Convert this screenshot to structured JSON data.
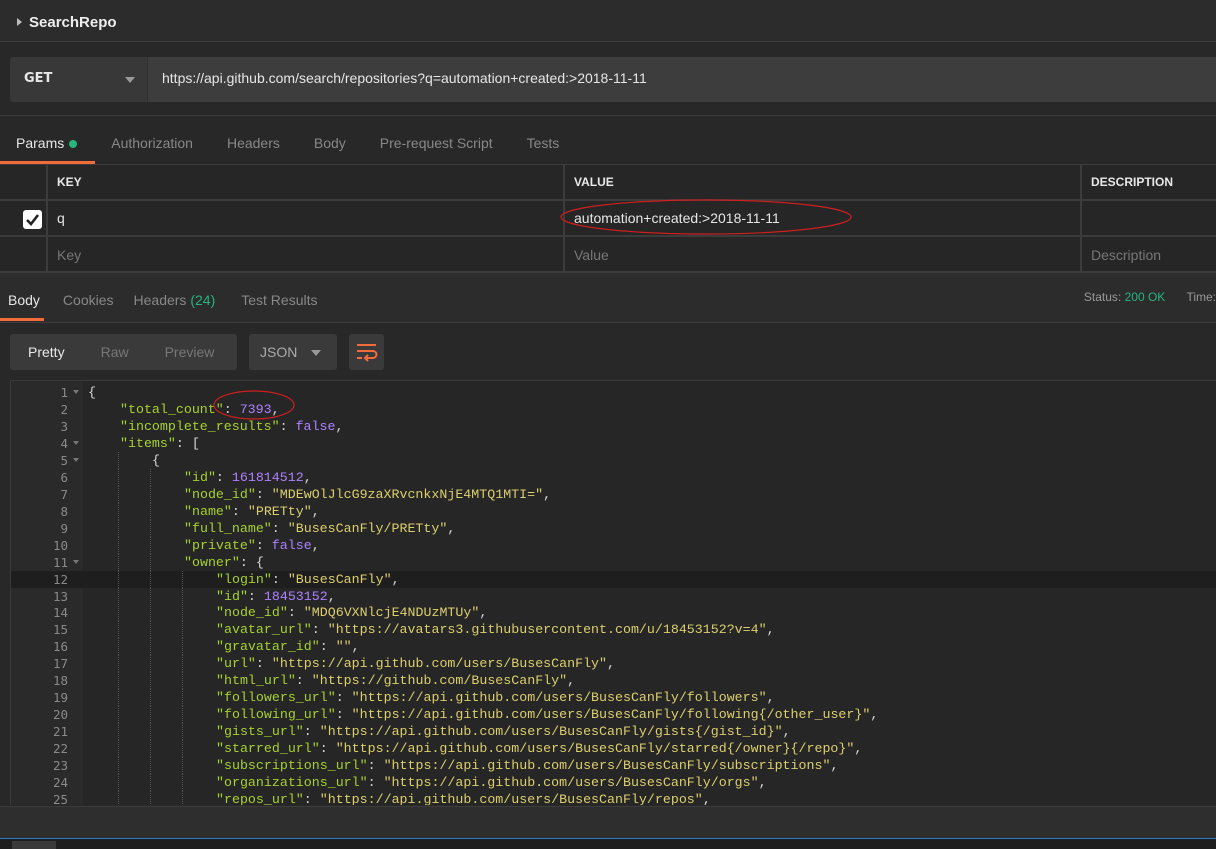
{
  "title": "SearchRepo",
  "request": {
    "method": "GET",
    "url": "https://api.github.com/search/repositories?q=automation+created:>2018-11-11"
  },
  "request_tabs": [
    "Params",
    "Authorization",
    "Headers",
    "Body",
    "Pre-request Script",
    "Tests"
  ],
  "params": {
    "columns": [
      "KEY",
      "VALUE",
      "DESCRIPTION"
    ],
    "rows": [
      {
        "checked": true,
        "key": "q",
        "value": "automation+created:>2018-11-11",
        "description": ""
      }
    ],
    "placeholders": {
      "key": "Key",
      "value": "Value",
      "description": "Description"
    }
  },
  "response_tabs": {
    "body": "Body",
    "cookies": "Cookies",
    "headers": "Headers",
    "headers_count": "(24)",
    "tests": "Test Results"
  },
  "status": {
    "label": "Status:",
    "value": "200 OK",
    "time_label": "Time:"
  },
  "view_modes": [
    "Pretty",
    "Raw",
    "Preview"
  ],
  "format": "JSON",
  "colors": {
    "accent": "#f26b3a",
    "success": "#26b47f",
    "key": "#a6d12f",
    "string": "#dccf6e",
    "number": "#ae81ff",
    "annotation": "#cc1f1f"
  },
  "icons": {
    "wrap": "wrap-lines-icon",
    "check": "checkbox-checked-icon",
    "dropdown": "chevron-down-icon"
  },
  "code_lines": [
    {
      "n": 1,
      "i": 0,
      "fold": true,
      "t": [
        [
          "p",
          "{"
        ]
      ]
    },
    {
      "n": 2,
      "i": 1,
      "t": [
        [
          "k",
          "\"total_count\""
        ],
        [
          "p",
          ": "
        ],
        [
          "n",
          "7393"
        ],
        [
          "p",
          ","
        ]
      ]
    },
    {
      "n": 3,
      "i": 1,
      "t": [
        [
          "k",
          "\"incomplete_results\""
        ],
        [
          "p",
          ": "
        ],
        [
          "n",
          "false"
        ],
        [
          "p",
          ","
        ]
      ]
    },
    {
      "n": 4,
      "i": 1,
      "fold": true,
      "t": [
        [
          "k",
          "\"items\""
        ],
        [
          "p",
          ": ["
        ]
      ]
    },
    {
      "n": 5,
      "i": 2,
      "fold": true,
      "t": [
        [
          "p",
          "{"
        ]
      ]
    },
    {
      "n": 6,
      "i": 3,
      "t": [
        [
          "k",
          "\"id\""
        ],
        [
          "p",
          ": "
        ],
        [
          "n",
          "161814512"
        ],
        [
          "p",
          ","
        ]
      ]
    },
    {
      "n": 7,
      "i": 3,
      "t": [
        [
          "k",
          "\"node_id\""
        ],
        [
          "p",
          ": "
        ],
        [
          "s",
          "\"MDEwOlJlcG9zaXRvcnkxNjE4MTQ1MTI=\""
        ],
        [
          "p",
          ","
        ]
      ]
    },
    {
      "n": 8,
      "i": 3,
      "t": [
        [
          "k",
          "\"name\""
        ],
        [
          "p",
          ": "
        ],
        [
          "s",
          "\"PRETty\""
        ],
        [
          "p",
          ","
        ]
      ]
    },
    {
      "n": 9,
      "i": 3,
      "t": [
        [
          "k",
          "\"full_name\""
        ],
        [
          "p",
          ": "
        ],
        [
          "s",
          "\"BusesCanFly/PRETty\""
        ],
        [
          "p",
          ","
        ]
      ]
    },
    {
      "n": 10,
      "i": 3,
      "t": [
        [
          "k",
          "\"private\""
        ],
        [
          "p",
          ": "
        ],
        [
          "n",
          "false"
        ],
        [
          "p",
          ","
        ]
      ]
    },
    {
      "n": 11,
      "i": 3,
      "fold": true,
      "t": [
        [
          "k",
          "\"owner\""
        ],
        [
          "p",
          ": {"
        ]
      ]
    },
    {
      "n": 12,
      "i": 4,
      "hl": true,
      "t": [
        [
          "k",
          "\"login\""
        ],
        [
          "p",
          ": "
        ],
        [
          "s",
          "\"BusesCanFly\""
        ],
        [
          "p",
          ","
        ]
      ]
    },
    {
      "n": 13,
      "i": 4,
      "t": [
        [
          "k",
          "\"id\""
        ],
        [
          "p",
          ": "
        ],
        [
          "n",
          "18453152"
        ],
        [
          "p",
          ","
        ]
      ]
    },
    {
      "n": 14,
      "i": 4,
      "t": [
        [
          "k",
          "\"node_id\""
        ],
        [
          "p",
          ": "
        ],
        [
          "s",
          "\"MDQ6VXNlcjE4NDUzMTUy\""
        ],
        [
          "p",
          ","
        ]
      ]
    },
    {
      "n": 15,
      "i": 4,
      "t": [
        [
          "k",
          "\"avatar_url\""
        ],
        [
          "p",
          ": "
        ],
        [
          "s",
          "\"https://avatars3.githubusercontent.com/u/18453152?v=4\""
        ],
        [
          "p",
          ","
        ]
      ]
    },
    {
      "n": 16,
      "i": 4,
      "t": [
        [
          "k",
          "\"gravatar_id\""
        ],
        [
          "p",
          ": "
        ],
        [
          "s",
          "\"\""
        ],
        [
          "p",
          ","
        ]
      ]
    },
    {
      "n": 17,
      "i": 4,
      "t": [
        [
          "k",
          "\"url\""
        ],
        [
          "p",
          ": "
        ],
        [
          "s",
          "\"https://api.github.com/users/BusesCanFly\""
        ],
        [
          "p",
          ","
        ]
      ]
    },
    {
      "n": 18,
      "i": 4,
      "t": [
        [
          "k",
          "\"html_url\""
        ],
        [
          "p",
          ": "
        ],
        [
          "s",
          "\"https://github.com/BusesCanFly\""
        ],
        [
          "p",
          ","
        ]
      ]
    },
    {
      "n": 19,
      "i": 4,
      "t": [
        [
          "k",
          "\"followers_url\""
        ],
        [
          "p",
          ": "
        ],
        [
          "s",
          "\"https://api.github.com/users/BusesCanFly/followers\""
        ],
        [
          "p",
          ","
        ]
      ]
    },
    {
      "n": 20,
      "i": 4,
      "t": [
        [
          "k",
          "\"following_url\""
        ],
        [
          "p",
          ": "
        ],
        [
          "s",
          "\"https://api.github.com/users/BusesCanFly/following{/other_user}\""
        ],
        [
          "p",
          ","
        ]
      ]
    },
    {
      "n": 21,
      "i": 4,
      "t": [
        [
          "k",
          "\"gists_url\""
        ],
        [
          "p",
          ": "
        ],
        [
          "s",
          "\"https://api.github.com/users/BusesCanFly/gists{/gist_id}\""
        ],
        [
          "p",
          ","
        ]
      ]
    },
    {
      "n": 22,
      "i": 4,
      "t": [
        [
          "k",
          "\"starred_url\""
        ],
        [
          "p",
          ": "
        ],
        [
          "s",
          "\"https://api.github.com/users/BusesCanFly/starred{/owner}{/repo}\""
        ],
        [
          "p",
          ","
        ]
      ]
    },
    {
      "n": 23,
      "i": 4,
      "t": [
        [
          "k",
          "\"subscriptions_url\""
        ],
        [
          "p",
          ": "
        ],
        [
          "s",
          "\"https://api.github.com/users/BusesCanFly/subscriptions\""
        ],
        [
          "p",
          ","
        ]
      ]
    },
    {
      "n": 24,
      "i": 4,
      "t": [
        [
          "k",
          "\"organizations_url\""
        ],
        [
          "p",
          ": "
        ],
        [
          "s",
          "\"https://api.github.com/users/BusesCanFly/orgs\""
        ],
        [
          "p",
          ","
        ]
      ]
    },
    {
      "n": 25,
      "i": 4,
      "t": [
        [
          "k",
          "\"repos_url\""
        ],
        [
          "p",
          ": "
        ],
        [
          "s",
          "\"https://api.github.com/users/BusesCanFly/repos\""
        ],
        [
          "p",
          ","
        ]
      ]
    }
  ]
}
